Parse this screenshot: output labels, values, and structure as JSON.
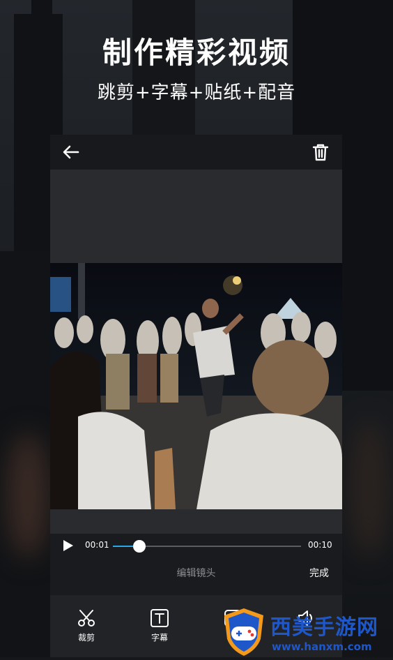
{
  "promo": {
    "headline": "制作精彩视频",
    "subheadline": "跳剪+字幕+贴纸+配音"
  },
  "editor": {
    "player": {
      "current_time": "00:01",
      "total_time": "00:10",
      "progress": 0.14
    },
    "section_title": "编辑镜头",
    "done_label": "完成",
    "tools": [
      {
        "label": "裁剪",
        "icon": "scissors-icon"
      },
      {
        "label": "字幕",
        "icon": "text-icon"
      },
      {
        "label": "",
        "icon": "sticker-icon"
      },
      {
        "label": "",
        "icon": "audio-icon"
      }
    ]
  },
  "watermark": {
    "name": "西美手游网",
    "url": "www.hanxm.com"
  },
  "colors": {
    "accent": "#2ea7e8",
    "panel": "#1a1b1e",
    "watermark_blue": "#1e57c9"
  }
}
